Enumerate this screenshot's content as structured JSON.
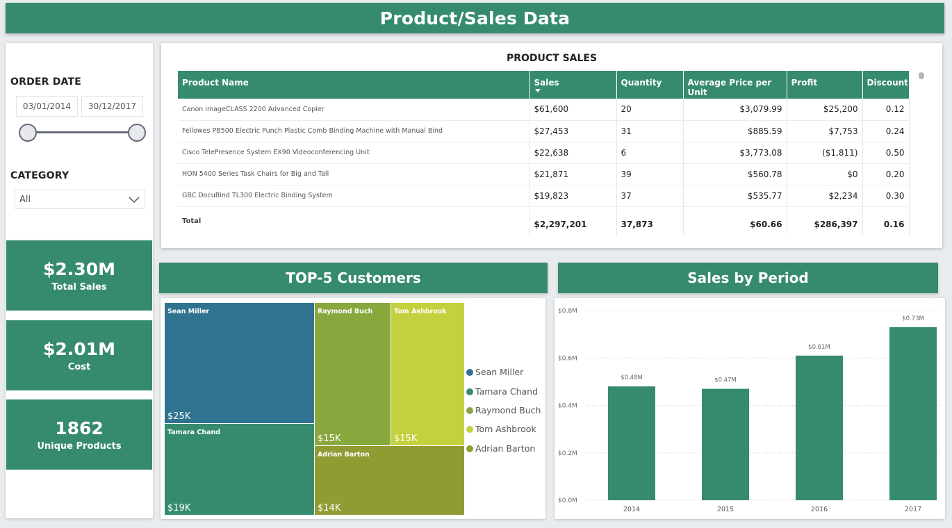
{
  "header": {
    "title": "Product/Sales Data"
  },
  "filters": {
    "order_date_label": "ORDER DATE",
    "date_start": "03/01/2014",
    "date_end": "30/12/2017",
    "category_label": "CATEGORY",
    "category_value": "All"
  },
  "kpis": [
    {
      "value": "$2.30M",
      "label": "Total Sales"
    },
    {
      "value": "$2.01M",
      "label": "Cost"
    },
    {
      "value": "1862",
      "label": "Unique Products"
    }
  ],
  "product_sales": {
    "title": "PRODUCT SALES",
    "columns": [
      "Product Name",
      "Sales",
      "Quantity",
      "Average Price per Unit",
      "Profit",
      "Discount"
    ],
    "rows": [
      [
        "Canon imageCLASS 2200 Advanced Copier",
        "$61,600",
        "20",
        "$3,079.99",
        "$25,200",
        "0.12"
      ],
      [
        "Fellowes PB500 Electric Punch Plastic Comb Binding Machine with Manual Bind",
        "$27,453",
        "31",
        "$885.59",
        "$7,753",
        "0.24"
      ],
      [
        "Cisco TelePresence System EX90 Videoconferencing Unit",
        "$22,638",
        "6",
        "$3,773.08",
        "($1,811)",
        "0.50"
      ],
      [
        "HON 5400 Series Task Chairs for Big and Tall",
        "$21,871",
        "39",
        "$560.78",
        "$0",
        "0.20"
      ],
      [
        "GBC DocuBind TL300 Electric Binding System",
        "$19,823",
        "37",
        "$535.77",
        "$2,234",
        "0.30"
      ]
    ],
    "total": [
      "Total",
      "$2,297,201",
      "37,873",
      "$60.66",
      "$286,397",
      "0.16"
    ]
  },
  "top_customers": {
    "title": "TOP-5 Customers",
    "items": [
      {
        "name": "Sean Miller",
        "value": "$25K",
        "color": "#2f7390"
      },
      {
        "name": "Tamara Chand",
        "value": "$19K",
        "color": "#368b6f"
      },
      {
        "name": "Raymond Buch",
        "value": "$15K",
        "color": "#88a83e"
      },
      {
        "name": "Tom Ashbrook",
        "value": "$15K",
        "color": "#c3d13f"
      },
      {
        "name": "Adrian Barton",
        "value": "$14K",
        "color": "#919b33"
      }
    ],
    "legend": [
      "Sean Miller",
      "Tamara Chand",
      "Raymond Buch",
      "Tom Ashbrook",
      "Adrian Barton"
    ]
  },
  "sales_by_period": {
    "title": "Sales by Period",
    "color": "#368b6f"
  },
  "chart_data": {
    "type": "bar",
    "categories": [
      "2014",
      "2015",
      "2016",
      "2017"
    ],
    "values": [
      0.48,
      0.47,
      0.61,
      0.73
    ],
    "data_labels": [
      "$0.48M",
      "$0.47M",
      "$0.61M",
      "$0.73M"
    ],
    "yticks": [
      "$0.0M",
      "$0.2M",
      "$0.4M",
      "$0.6M",
      "$0.8M"
    ],
    "ylim": [
      0,
      0.8
    ],
    "grid": true,
    "title": "Sales by Period"
  }
}
